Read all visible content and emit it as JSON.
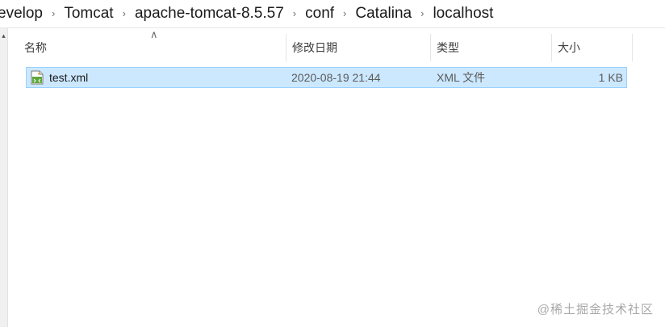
{
  "breadcrumb": [
    "evelop",
    "Tomcat",
    "apache-tomcat-8.5.57",
    "conf",
    "Catalina",
    "localhost"
  ],
  "columns": {
    "name": "名称",
    "date": "修改日期",
    "type": "类型",
    "size": "大小"
  },
  "files": [
    {
      "name": "test.xml",
      "date": "2020-08-19 21:44",
      "type": "XML 文件",
      "size": "1 KB",
      "icon": "xml-file-icon"
    }
  ],
  "watermark": "@稀土掘金技术社区",
  "colors": {
    "selection_bg": "#cce8ff",
    "selection_border": "#99d1ff"
  }
}
